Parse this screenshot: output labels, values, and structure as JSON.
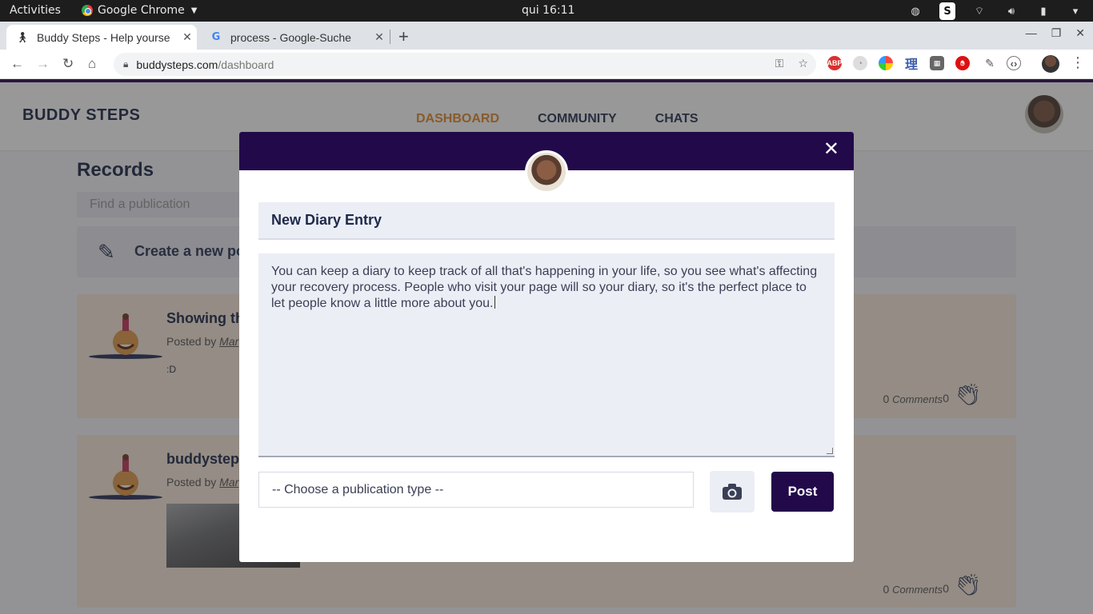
{
  "os_bar": {
    "activities": "Activities",
    "app_name": "Google Chrome",
    "clock": "qui 16:11",
    "tray_icons": [
      "steam-icon",
      "skype-icon",
      "wifi-icon",
      "volume-icon",
      "battery-icon",
      "power-caret-icon"
    ]
  },
  "browser": {
    "tabs": [
      {
        "title": "Buddy Steps - Help yourse",
        "favicon": "buddy-steps-favicon",
        "active": true
      },
      {
        "title": "process - Google-Suche",
        "favicon": "google-favicon",
        "active": false
      }
    ],
    "url_host": "buddysteps.com",
    "url_path": "/dashboard",
    "extensions": [
      "adblock-plus-icon",
      "timer-icon",
      "color-picker-icon",
      "dictionary-icon",
      "grid-icon",
      "ublock-icon",
      "dev-tools-icon",
      "code-icon"
    ]
  },
  "site": {
    "brand": "BUDDY STEPS",
    "nav": [
      {
        "label": "DASHBOARD",
        "active": true
      },
      {
        "label": "COMMUNITY",
        "active": false
      },
      {
        "label": "CHATS",
        "active": false
      }
    ],
    "accent_color": "#220a4a",
    "active_nav_color": "#e08b2c"
  },
  "records": {
    "title": "Records",
    "search_placeholder": "Find a publication",
    "create_label": "Create a new po"
  },
  "posts": [
    {
      "title": "Showing th",
      "posted_prefix": "Posted by",
      "author": "Mar",
      "body": ":D",
      "comments_count": "0",
      "comments_label": "Comments",
      "likes": "0"
    },
    {
      "title": "buddystep",
      "posted_prefix": "Posted by",
      "author": "Mar",
      "body": "",
      "comments_count": "0",
      "comments_label": "Comments",
      "likes": "0"
    }
  ],
  "modal": {
    "title_value": "New Diary Entry",
    "body_value": "You can keep a diary to keep track of all that's happening in your life, so you see what's affecting your recovery process. People who visit your page will so your diary, so it's the perfect place to let people know a little more about you.",
    "type_placeholder": "-- Choose a publication type --",
    "post_label": "Post",
    "close_symbol": "✕"
  }
}
